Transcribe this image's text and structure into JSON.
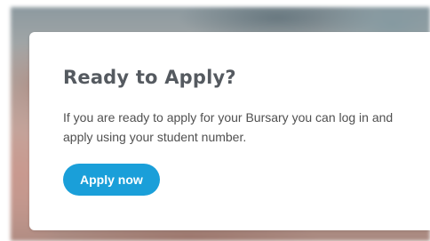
{
  "card": {
    "title": "Ready to Apply?",
    "text": "If you are ready to apply for your Bursary you can log in and apply using your student number.",
    "button_label": "Apply now"
  },
  "colors": {
    "button": "#1a9fd9",
    "title": "#555a60",
    "text": "#505050"
  }
}
